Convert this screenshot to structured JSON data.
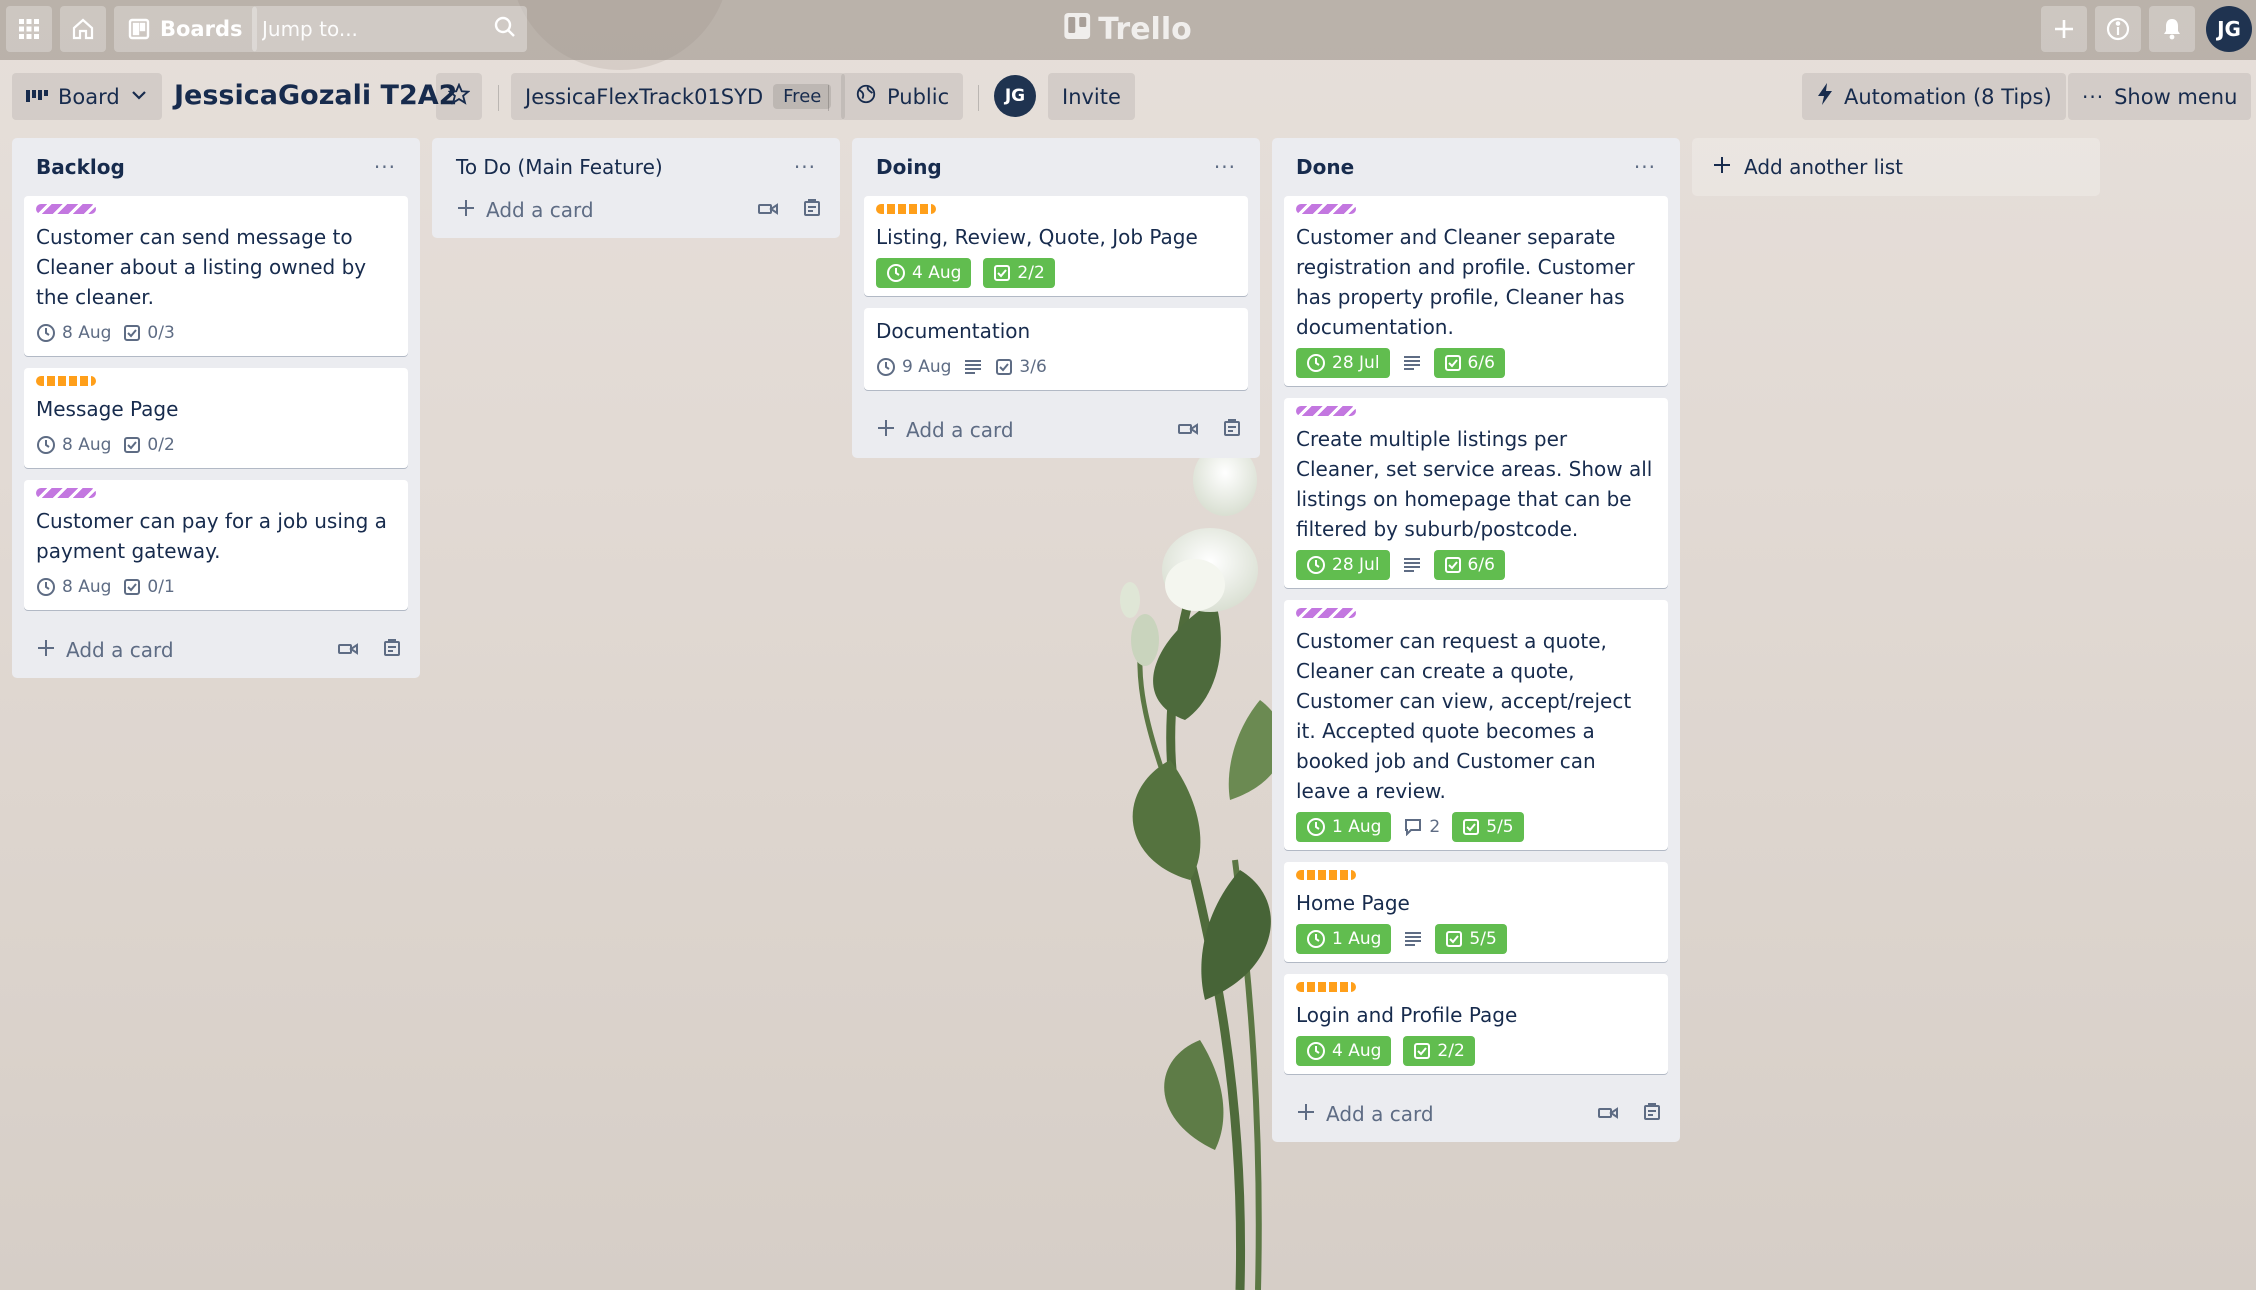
{
  "topbar": {
    "boards_label": "Boards",
    "search_placeholder": "Jump to...",
    "logo_text": "Trello",
    "user_initials": "JG"
  },
  "board": {
    "view_label": "Board",
    "title": "JessicaGozali T2A2",
    "workspace": "JessicaFlexTrack01SYD",
    "workspace_tag": "Free",
    "visibility": "Public",
    "member_initials": "JG",
    "invite_label": "Invite",
    "automation_label": "Automation (8 Tips)",
    "show_menu_label": "Show menu"
  },
  "lists": [
    {
      "title": "Backlog",
      "cards": [
        {
          "label": "purple",
          "title": "Customer can send message to Cleaner about a listing owned by the cleaner.",
          "due": "8 Aug",
          "checklist": "0/3"
        },
        {
          "label": "orange",
          "title": "Message Page",
          "due": "8 Aug",
          "checklist": "0/2"
        },
        {
          "label": "purple",
          "title": "Customer can pay for a job using a payment gateway.",
          "due": "8 Aug",
          "checklist": "0/1"
        }
      ],
      "add_label": "Add a card"
    },
    {
      "title": "To Do (Main Feature)",
      "cards": [],
      "add_label": "Add a card"
    },
    {
      "title": "Doing",
      "cards": [
        {
          "label": "orange",
          "title": "Listing, Review, Quote, Job Page",
          "due": "4 Aug",
          "checklist": "2/2"
        },
        {
          "label": "",
          "title": "Documentation",
          "due": "9 Aug",
          "checklist": "3/6"
        }
      ],
      "add_label": "Add a card"
    },
    {
      "title": "Done",
      "cards": [
        {
          "label": "purple",
          "title": "Customer and Cleaner separate registration and profile. Customer has property profile, Cleaner has documentation.",
          "due": "28 Jul",
          "checklist": "6/6"
        },
        {
          "label": "purple",
          "title": "Create multiple listings per Cleaner, set service areas. Show all listings on homepage that can be filtered by suburb/postcode.",
          "due": "28 Jul",
          "checklist": "6/6"
        },
        {
          "label": "purple",
          "title": "Customer can request a quote, Cleaner can create a quote, Customer can view, accept/reject it. Accepted quote becomes a booked job and Customer can leave a review.",
          "due": "1 Aug",
          "comments": "2",
          "checklist": "5/5"
        },
        {
          "label": "orange",
          "title": "Home Page",
          "due": "1 Aug",
          "checklist": "5/5"
        },
        {
          "label": "orange",
          "title": "Login and Profile Page",
          "due": "4 Aug",
          "checklist": "2/2"
        }
      ],
      "add_label": "Add a card"
    }
  ],
  "add_list_label": "Add another list",
  "colors": {
    "label_purple": "#c377e0",
    "label_orange": "#ff9f1a",
    "badge_green": "#61bd4f",
    "list_bg": "#ebecf0"
  }
}
